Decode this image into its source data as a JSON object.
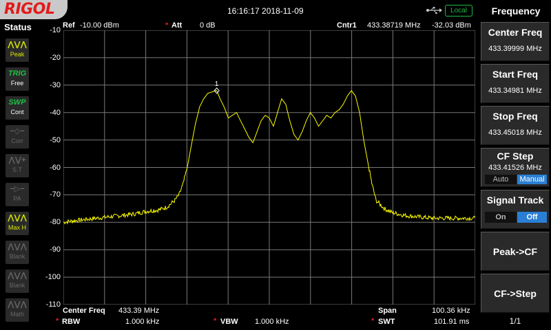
{
  "brand": "RIGOL",
  "datetime": "16:16:17 2018-11-09",
  "local_label": "Local",
  "status": {
    "title": "Status",
    "items": [
      {
        "icon": "peak-icon",
        "glyph": "⋀⋁⋀",
        "label": "Peak",
        "state": "on"
      },
      {
        "icon": "trig-icon",
        "glyph": "TRIG",
        "label": "Free",
        "state": "on2"
      },
      {
        "icon": "sweep-icon",
        "glyph": "SWP",
        "label": "Cont",
        "state": "on2"
      },
      {
        "icon": "corr-icon",
        "glyph": "−◇−",
        "label": "Corr",
        "state": "off"
      },
      {
        "icon": "tracking-source-icon",
        "glyph": "⋀⋁+",
        "label": "S.T",
        "state": "off"
      },
      {
        "icon": "preamp-icon",
        "glyph": "−▷−",
        "label": "PA",
        "state": "off"
      },
      {
        "icon": "max-hold-icon",
        "glyph": "⋀⋁⋀",
        "label": "Max H",
        "state": "on"
      },
      {
        "icon": "blank-icon",
        "glyph": "⋀⋁⋀",
        "label": "Blank",
        "state": "off"
      },
      {
        "icon": "blank-icon",
        "glyph": "⋀⋁⋀",
        "label": "Blank",
        "state": "off"
      },
      {
        "icon": "math-icon",
        "glyph": "⋀⋁⋀",
        "label": "Math",
        "state": "off"
      }
    ]
  },
  "header": {
    "ref_label": "Ref",
    "ref_value": "-10.00 dBm",
    "att_label": "Att",
    "att_value": "0 dB",
    "cntr_label": "Cntr1",
    "cntr_freq": "433.38719 MHz",
    "cntr_amp": "-32.03 dBm"
  },
  "footer": {
    "center_label": "Center Freq",
    "center_value": "433.39 MHz",
    "span_label": "Span",
    "span_value": "100.36 kHz",
    "rbw_label": "RBW",
    "rbw_value": "1.000 kHz",
    "vbw_label": "VBW",
    "vbw_value": "1.000 kHz",
    "swt_label": "SWT",
    "swt_value": "101.91 ms"
  },
  "menu": {
    "title": "Frequency",
    "center_freq": {
      "label": "Center Freq",
      "value": "433.39999 MHz"
    },
    "start_freq": {
      "label": "Start Freq",
      "value": "433.34981 MHz"
    },
    "stop_freq": {
      "label": "Stop Freq",
      "value": "433.45018 MHz"
    },
    "cf_step": {
      "label": "CF Step",
      "value": "433.41526 MHz",
      "opt_auto": "Auto",
      "opt_manual": "Manual"
    },
    "signal_track": {
      "label": "Signal Track",
      "opt_on": "On",
      "opt_off": "Off"
    },
    "peak_cf": "Peak->CF",
    "cf_step_btn": "CF->Step",
    "page": "1/1"
  },
  "colors": {
    "trace": "#ffff00",
    "grid": "#7a7a7a",
    "marker_star": "#e02020",
    "active_toggle": "#2a7fd4",
    "local_badge": "#1fbf45",
    "brand": "#e31b1b"
  },
  "chart_data": {
    "type": "line",
    "ylabel": "dBm",
    "ylim": [
      -110,
      -10
    ],
    "y_ticks": [
      "-10",
      "-20",
      "-30",
      "-40",
      "-50",
      "-60",
      "-70",
      "-80",
      "-90",
      "-100",
      "-110"
    ],
    "x_range_khz": [
      433349.81,
      433450.18
    ],
    "marker": {
      "label": "1",
      "freq_mhz": 433.38719,
      "amp_dbm": -32.03
    },
    "series": [
      {
        "x_khz": [
          433349.81,
          433352,
          433355,
          433358,
          433361,
          433364,
          433367,
          433370,
          433373,
          433375,
          433377,
          433378,
          433379,
          433380,
          433381,
          433382,
          433383,
          433384,
          433385,
          433386,
          433387,
          433387.19,
          433388,
          433389,
          433390,
          433391,
          433392,
          433393,
          433394,
          433395,
          433396,
          433397,
          433398,
          433399,
          433400,
          433401,
          433402,
          433403,
          433404,
          433405,
          433406,
          433407,
          433408,
          433409,
          433410,
          433411,
          433412,
          433413,
          433414,
          433415,
          433416,
          433417,
          433418,
          433419,
          433420,
          433421,
          433422,
          433423,
          433424,
          433425,
          433426,
          433428,
          433430,
          433433,
          433436,
          433440,
          433445,
          433450.18
        ],
        "y_dbm": [
          -80,
          -79.5,
          -79,
          -78.5,
          -78,
          -77.5,
          -77,
          -76,
          -75.5,
          -74.5,
          -72,
          -70,
          -66,
          -60,
          -52,
          -44,
          -38,
          -35,
          -33,
          -32.5,
          -32,
          -32.03,
          -35,
          -38,
          -42,
          -41,
          -40,
          -43,
          -46,
          -49,
          -51,
          -47,
          -43,
          -41,
          -42,
          -45,
          -40,
          -35,
          -37,
          -43,
          -48,
          -50,
          -47,
          -43,
          -40,
          -42,
          -45,
          -43,
          -41,
          -42,
          -40,
          -39,
          -37,
          -34,
          -32,
          -34,
          -40,
          -50,
          -58,
          -66,
          -72,
          -75,
          -76.5,
          -77.5,
          -78,
          -78.5,
          -78.5,
          -78.5
        ]
      }
    ]
  }
}
